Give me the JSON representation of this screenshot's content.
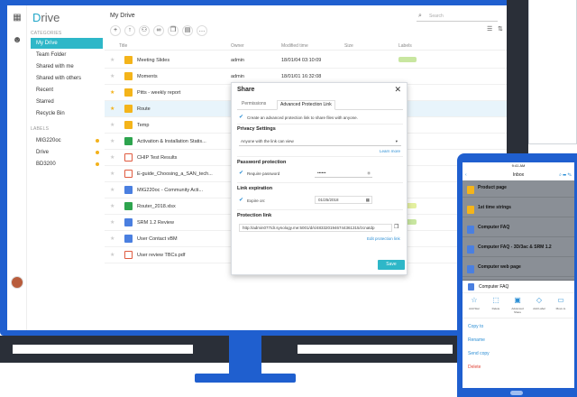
{
  "app": {
    "logo_prefix": "D",
    "logo_rest": "rive"
  },
  "nav": {
    "section_categories": "CATEGORIES",
    "items": [
      {
        "label": "My Drive",
        "active": true
      },
      {
        "label": "Team Folder"
      },
      {
        "label": "Shared with me"
      },
      {
        "label": "Shared with others"
      },
      {
        "label": "Recent"
      },
      {
        "label": "Starred"
      },
      {
        "label": "Recycle Bin"
      }
    ],
    "section_labels": "LABELS",
    "labels": [
      {
        "label": "MIG220oc",
        "color": "#f3b21b"
      },
      {
        "label": "Drive",
        "color": "#f3b21b"
      },
      {
        "label": "BD3200",
        "color": "#f3b21b"
      }
    ]
  },
  "main": {
    "breadcrumb": "My Drive",
    "search_placeholder": "Search",
    "columns": {
      "title": "Title",
      "owner": "Owner",
      "modified": "Modified time",
      "size": "Size",
      "labels": "Labels"
    },
    "rows": [
      {
        "name": "Meeting Slides",
        "owner": "admin",
        "modified": "18/01/04 03:10:09",
        "type": "folder",
        "starred": false,
        "tag": "#c8e6a0"
      },
      {
        "name": "Moments",
        "owner": "admin",
        "modified": "18/01/01 16:32:08",
        "type": "folder",
        "starred": false,
        "tag": ""
      },
      {
        "name": "Pitts - weekly report",
        "owner": "",
        "modified": "",
        "type": "folder",
        "starred": true,
        "tag": ""
      },
      {
        "name": "Route",
        "owner": "",
        "modified": "",
        "type": "folder",
        "starred": true,
        "tag": "",
        "highlight": true
      },
      {
        "name": "Temp",
        "owner": "",
        "modified": "",
        "type": "folder",
        "starred": false,
        "tag": ""
      },
      {
        "name": "Activation & Installation Statis...",
        "owner": "",
        "modified": "",
        "type": "sheet",
        "starred": false,
        "tag": ""
      },
      {
        "name": "CHIP Test Results",
        "owner": "",
        "modified": "",
        "type": "pdf",
        "starred": false,
        "tag": ""
      },
      {
        "name": "E-guide_Choosing_a_SAN_tech...",
        "owner": "",
        "modified": "",
        "type": "pdf",
        "starred": false,
        "tag": ""
      },
      {
        "name": "MIG220oc - Community Acti...",
        "owner": "",
        "modified": "",
        "type": "doc",
        "starred": false,
        "tag": ""
      },
      {
        "name": "Router_2018.xlsx",
        "owner": "",
        "modified": "",
        "type": "sheet",
        "starred": false,
        "tag": "#e4f0a0"
      },
      {
        "name": "SRM 1.2 Review",
        "owner": "",
        "modified": "",
        "type": "doc",
        "starred": false,
        "tag": "#c8e6a0"
      },
      {
        "name": "User Contact vBM",
        "owner": "",
        "modified": "",
        "type": "doc",
        "starred": false,
        "tag": ""
      },
      {
        "name": "User review TBCs.pdf",
        "owner": "",
        "modified": "",
        "type": "pdf",
        "starred": false,
        "tag": ""
      }
    ]
  },
  "dialog": {
    "title": "Share",
    "tabs": [
      "Permissions",
      "Advanced Protection Link"
    ],
    "create_label": "Create an advanced protection link to share files with anyone.",
    "privacy_title": "Privacy Settings",
    "privacy_value": "Anyone with the link can view",
    "learn_more": "Learn more",
    "password_title": "Password protection",
    "password_check": "Require password",
    "password_value": "••••••",
    "expiration_title": "Link expiration",
    "expire_check": "Expire on:",
    "expire_date": "01/25/2018",
    "protection_title": "Protection link",
    "link_value": "http://admin077/dr.synology.me:5001/d/s/4833201946744361315/zcnatdp",
    "edit_link": "Edit protection link",
    "save": "Save"
  },
  "phone": {
    "status": "9:41 AM",
    "nav_title": "Inbox",
    "back": "‹",
    "tools": "⌕ ☰ ✎",
    "items": [
      {
        "name": "Product page",
        "sub": "",
        "type": "folder"
      },
      {
        "name": "1st time strings",
        "sub": "",
        "type": "folder"
      },
      {
        "name": "Computer FAQ",
        "sub": "",
        "type": "doc"
      },
      {
        "name": "Computer FAQ - 3D/3ac & SRM 1.2",
        "sub": "",
        "type": "doc"
      },
      {
        "name": "Computer web page",
        "sub": "",
        "type": "doc"
      }
    ],
    "menu_title": "Computer FAQ",
    "menu_icons": [
      {
        "glyph": "☆",
        "label": "Add Star"
      },
      {
        "glyph": "⬚",
        "label": "Delete"
      },
      {
        "glyph": "▣",
        "label": "Advanced Share"
      },
      {
        "glyph": "◇",
        "label": "Add Label"
      },
      {
        "glyph": "▭",
        "label": "Move to"
      }
    ],
    "menu_rows": [
      "Copy to",
      "Rename",
      "Send copy",
      "Delete"
    ]
  }
}
